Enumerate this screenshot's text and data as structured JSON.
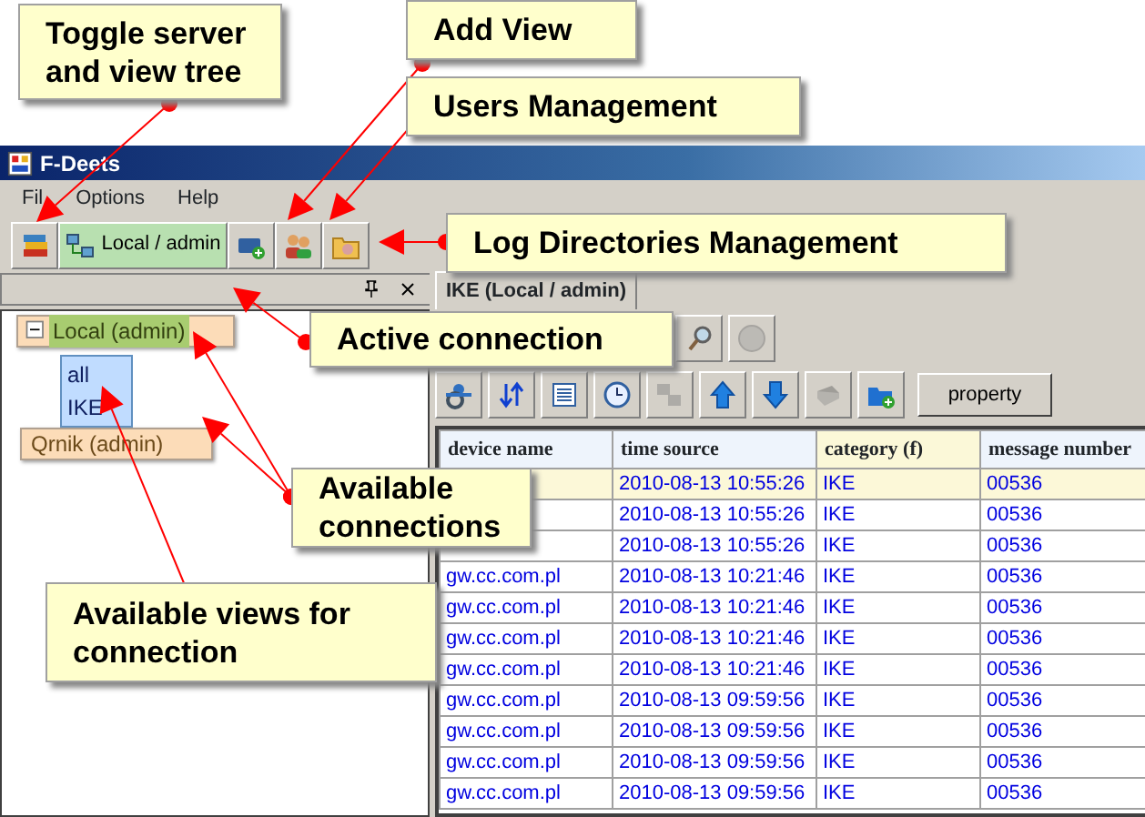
{
  "window": {
    "title": "F-Deets"
  },
  "menu": [
    {
      "label": "Fil"
    },
    {
      "label": "Options"
    },
    {
      "label": "Help"
    }
  ],
  "connection_button": {
    "label": "Local / admin"
  },
  "tree": [
    {
      "label": "Local (admin)",
      "expanded": true,
      "active": true,
      "children": [
        {
          "label": "all"
        },
        {
          "label": "IKE"
        }
      ]
    },
    {
      "label": "Qrnik (admin)",
      "active": false
    }
  ],
  "tab": {
    "label": "IKE (Local / admin)",
    "selected": true
  },
  "search_toolbar": [
    {
      "disabled": false
    },
    {
      "disabled": true
    }
  ],
  "view_toolbar": [
    {
      "disabled": false
    },
    {
      "disabled": false
    },
    {
      "disabled": false
    },
    {
      "disabled": false
    },
    {
      "disabled": true
    },
    {
      "disabled": false
    },
    {
      "disabled": false
    },
    {
      "disabled": true
    },
    {
      "disabled": false
    }
  ],
  "property_button": {
    "label": "property"
  },
  "table": {
    "columns": [
      {
        "label": "device name",
        "highlighted": false
      },
      {
        "label": "time source",
        "highlighted": false
      },
      {
        "label": "category (f)",
        "highlighted": true
      },
      {
        "label": "message number",
        "highlighted": false
      }
    ],
    "rows": [
      {
        "time_source": "2010-08-13 10:55:26",
        "category": "IKE",
        "message_number": "00536",
        "selected": true
      },
      {
        "time_source": "2010-08-13 10:55:26",
        "category": "IKE",
        "message_number": "00536",
        "selected": false
      },
      {
        "time_source": "2010-08-13 10:55:26",
        "category": "IKE",
        "message_number": "00536",
        "selected": false
      },
      {
        "device_name": "gw.cc.com.pl",
        "time_source": "2010-08-13 10:21:46",
        "category": "IKE",
        "message_number": "00536",
        "selected": false
      },
      {
        "device_name": "gw.cc.com.pl",
        "time_source": "2010-08-13 10:21:46",
        "category": "IKE",
        "message_number": "00536",
        "selected": false
      },
      {
        "device_name": "gw.cc.com.pl",
        "time_source": "2010-08-13 10:21:46",
        "category": "IKE",
        "message_number": "00536",
        "selected": false
      },
      {
        "device_name": "gw.cc.com.pl",
        "time_source": "2010-08-13 10:21:46",
        "category": "IKE",
        "message_number": "00536",
        "selected": false
      },
      {
        "device_name": "gw.cc.com.pl",
        "time_source": "2010-08-13 09:59:56",
        "category": "IKE",
        "message_number": "00536",
        "selected": false
      },
      {
        "device_name": "gw.cc.com.pl",
        "time_source": "2010-08-13 09:59:56",
        "category": "IKE",
        "message_number": "00536",
        "selected": false
      },
      {
        "device_name": "gw.cc.com.pl",
        "time_source": "2010-08-13 09:59:56",
        "category": "IKE",
        "message_number": "00536",
        "selected": false
      },
      {
        "device_name": "gw.cc.com.pl",
        "time_source": "2010-08-13 09:59:56",
        "category": "IKE",
        "message_number": "00536",
        "selected": false
      }
    ]
  },
  "callouts": [
    {
      "lines": [
        "Toggle server",
        "and view tree"
      ]
    },
    {
      "lines": [
        "Add View"
      ]
    },
    {
      "lines": [
        "Users Management"
      ]
    },
    {
      "lines": [
        "Log Directories Management"
      ]
    },
    {
      "lines": [
        "Active connection"
      ]
    },
    {
      "lines": [
        "Available",
        "connections"
      ]
    },
    {
      "lines": [
        "Available views for",
        "connection"
      ]
    }
  ]
}
